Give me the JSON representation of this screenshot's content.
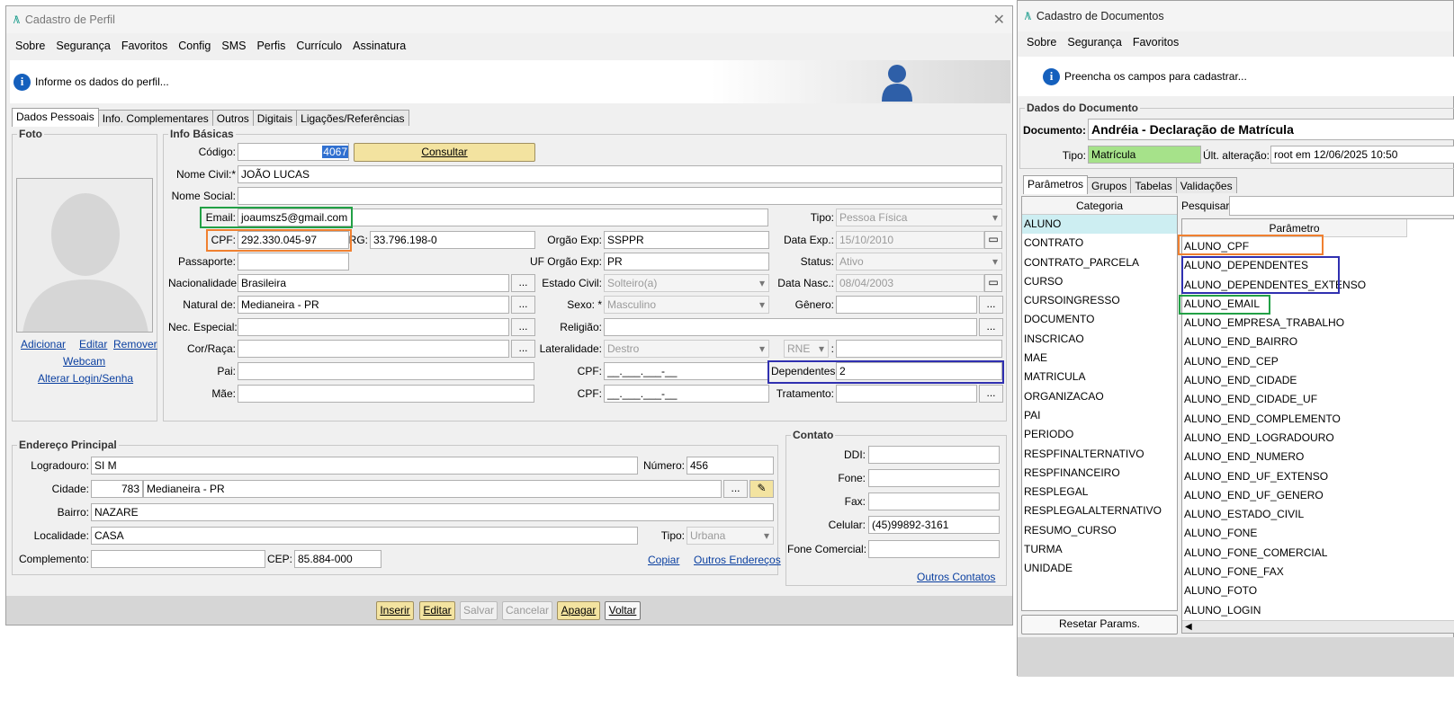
{
  "profile_window": {
    "title": "Cadastro de Perfil",
    "menu": [
      "Sobre",
      "Segurança",
      "Favoritos",
      "Config",
      "SMS",
      "Perfis",
      "Currículo",
      "Assinatura"
    ],
    "info_text": "Informe os dados do perfil...",
    "tabs": [
      "Dados Pessoais",
      "Info. Complementares",
      "Outros",
      "Digitais",
      "Ligações/Referências"
    ],
    "foto": {
      "legend": "Foto",
      "adicionar": "Adicionar",
      "editar": "Editar",
      "remover": "Remover",
      "webcam": "Webcam",
      "alterar_login": "Alterar Login/Senha"
    },
    "info_basicas": {
      "legend": "Info Básicas",
      "codigo_label": "Código:",
      "codigo": "4067",
      "consultar": "Consultar",
      "nome_civil_label": "Nome Civil:*",
      "nome_civil": "JOÃO LUCAS",
      "nome_social_label": "Nome Social:",
      "nome_social": "",
      "email_label": "Email:",
      "email": "joaumsz5@gmail.com",
      "tipo_label": "Tipo:",
      "tipo": "Pessoa Física",
      "cpf_label": "CPF:",
      "cpf": "292.330.045-97",
      "rg_label": "RG:",
      "rg": "33.796.198-0",
      "orgao_exp_label": "Orgão Exp:",
      "orgao_exp": "SSPPR",
      "data_exp_label": "Data Exp.:",
      "data_exp": "15/10/2010",
      "passaporte_label": "Passaporte:",
      "passaporte": "",
      "uf_orgao_label": "UF Orgão Exp:",
      "uf_orgao": "PR",
      "status_label": "Status:",
      "status": "Ativo",
      "nacionalidade_label": "Nacionalidade:",
      "nacionalidade": "Brasileira",
      "estado_civil_label": "Estado Civil:",
      "estado_civil": "Solteiro(a)",
      "data_nasc_label": "Data Nasc.:",
      "data_nasc": "08/04/2003",
      "natural_label": "Natural de:",
      "natural": "Medianeira - PR",
      "sexo_label": "Sexo: *",
      "sexo": "Masculino",
      "genero_label": "Gênero:",
      "genero": "",
      "nec_especial_label": "Nec. Especial:",
      "religiao_label": "Religião:",
      "cor_raca_label": "Cor/Raça:",
      "lateralidade_label": "Lateralidade:",
      "lateralidade": "Destro",
      "rne": "RNE",
      "pai_label": "Pai:",
      "pai_cpf_label": "CPF:",
      "cpf_mask": "__.___.___-__",
      "dependentes_label": "Dependentes:",
      "dependentes": "2",
      "mae_label": "Mãe:",
      "mae_cpf_label": "CPF:",
      "tratamento_label": "Tratamento:",
      "colon": ":",
      "dots": "..."
    },
    "endereco": {
      "legend": "Endereço Principal",
      "logradouro_label": "Logradouro:",
      "logradouro": "SI M",
      "numero_label": "Número:",
      "numero": "456",
      "cidade_label": "Cidade:",
      "cidade_cod": "783",
      "cidade": "Medianeira - PR",
      "bairro_label": "Bairro:",
      "bairro": "NAZARE",
      "localidade_label": "Localidade:",
      "localidade": "CASA",
      "tipo_label": "Tipo:",
      "tipo": "Urbana",
      "complemento_label": "Complemento:",
      "cep_label": "CEP:",
      "cep": "85.884-000",
      "copiar": "Copiar",
      "outros_enderecos": "Outros Endereços"
    },
    "contato": {
      "legend": "Contato",
      "ddi_label": "DDI:",
      "fone_label": "Fone:",
      "fax_label": "Fax:",
      "celular_label": "Celular:",
      "celular": "(45)99892-3161",
      "fone_comercial_label": "Fone Comercial:",
      "outros_contatos": "Outros Contatos"
    },
    "buttons": [
      "Inserir",
      "Editar",
      "Salvar",
      "Cancelar",
      "Apagar",
      "Voltar"
    ]
  },
  "doc_window": {
    "title": "Cadastro de Documentos",
    "menu": [
      "Sobre",
      "Segurança",
      "Favoritos"
    ],
    "info_text": "Preencha os campos para cadastrar...",
    "legend": "Dados do Documento",
    "documento_label": "Documento:",
    "documento": "Andréia - Declaração de Matrícula",
    "tipo_label": "Tipo:",
    "tipo": "Matrícula",
    "ult_label": "Últ. alteração:",
    "ult": "root em 12/06/2025 10:50",
    "tabs": [
      "Parâmetros",
      "Grupos",
      "Tabelas",
      "Validações"
    ],
    "categoria_header": "Categoria",
    "categorias": [
      "ALUNO",
      "CONTRATO",
      "CONTRATO_PARCELA",
      "CURSO",
      "CURSOINGRESSO",
      "DOCUMENTO",
      "INSCRICAO",
      "MAE",
      "MATRICULA",
      "ORGANIZACAO",
      "PAI",
      "PERIODO",
      "RESPFINALTERNATIVO",
      "RESPFINANCEIRO",
      "RESPLEGAL",
      "RESPLEGALALTERNATIVO",
      "RESUMO_CURSO",
      "TURMA",
      "UNIDADE"
    ],
    "pesquisar_label": "Pesquisar:",
    "parametro_header": "Parâmetro",
    "parametros": [
      "ALUNO_CPF",
      "ALUNO_DEPENDENTES",
      "ALUNO_DEPENDENTES_EXTENSO",
      "ALUNO_EMAIL",
      "ALUNO_EMPRESA_TRABALHO",
      "ALUNO_END_BAIRRO",
      "ALUNO_END_CEP",
      "ALUNO_END_CIDADE",
      "ALUNO_END_CIDADE_UF",
      "ALUNO_END_COMPLEMENTO",
      "ALUNO_END_LOGRADOURO",
      "ALUNO_END_NUMERO",
      "ALUNO_END_UF_EXTENSO",
      "ALUNO_END_UF_GENERO",
      "ALUNO_ESTADO_CIVIL",
      "ALUNO_FONE",
      "ALUNO_FONE_COMERCIAL",
      "ALUNO_FONE_FAX",
      "ALUNO_FOTO",
      "ALUNO_LOGIN"
    ],
    "resetar": "Resetar Params."
  },
  "colors": {
    "highlight_green": "#22a045",
    "highlight_orange": "#f08030",
    "highlight_blue": "#3030b0",
    "selected_category": "#cdeef2",
    "tipo_green": "#a6e28a"
  }
}
